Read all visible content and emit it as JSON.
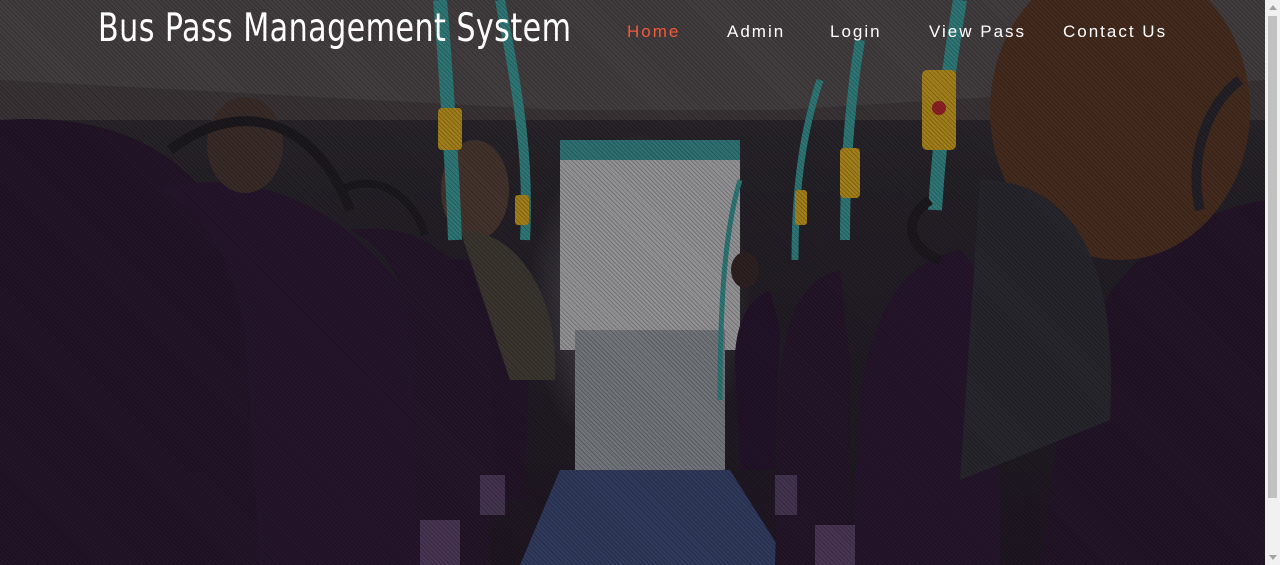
{
  "header": {
    "brand": "Bus Pass Management System"
  },
  "nav": {
    "items": [
      {
        "label": "Home",
        "active": true
      },
      {
        "label": "Admin",
        "active": false
      },
      {
        "label": "Login",
        "active": false
      },
      {
        "label": "View Pass",
        "active": false
      },
      {
        "label": "Contact Us",
        "active": false
      }
    ]
  },
  "colors": {
    "active_nav": "#f15b3a",
    "nav_text": "#ffffff",
    "seat_purple": "#2c1a33",
    "pole_teal": "#3aa6a0",
    "handle_yellow": "#e0b21c"
  },
  "background": {
    "image": "bus-interior-photo"
  }
}
